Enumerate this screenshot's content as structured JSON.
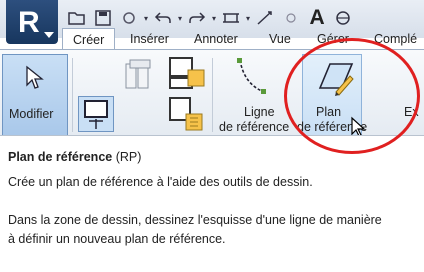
{
  "tabs": [
    "Créer",
    "Insérer",
    "Annoter",
    "Vue",
    "Gérer",
    "Complé"
  ],
  "ribbon": {
    "modifier_label": "Modifier",
    "ligne_line1": "Ligne",
    "ligne_line2": "de référence",
    "plan_line1": "Plan",
    "plan_line2": "de référence",
    "extrusion_partial": "Ex"
  },
  "tooltip": {
    "title": "Plan de référence",
    "shortcut": "(RP)",
    "line1": "Crée un plan de référence à l'aide des outils de dessin.",
    "line2": "Dans la zone de dessin, dessinez l'esquisse d'une ligne de manière",
    "line3": "à définir un nouveau plan de référence."
  },
  "icons": [
    "open-icon",
    "save-icon",
    "undo-icon",
    "redo-icon",
    "measure-icon",
    "dimension-icon",
    "text-icon",
    "3d-view-icon"
  ],
  "colors": {
    "accent": "#e02020",
    "app": "#1f3f6b",
    "pressed": "#c9dff5"
  }
}
